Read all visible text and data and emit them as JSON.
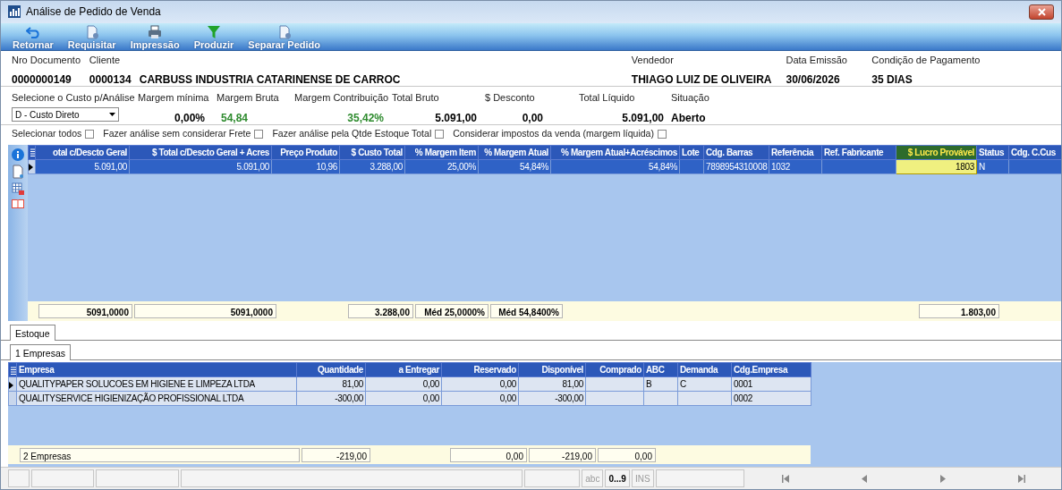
{
  "window": {
    "title": "Análise de Pedido de Venda"
  },
  "toolbar": [
    {
      "label": "Retornar",
      "kind": "undo"
    },
    {
      "label": "Requisitar",
      "kind": "document"
    },
    {
      "label": "Impressão",
      "kind": "printer"
    },
    {
      "label": "Produzir",
      "kind": "filter"
    },
    {
      "label": "Separar Pedido",
      "kind": "document"
    }
  ],
  "header": [
    {
      "label": "Nro Documento",
      "value": "0000000149"
    },
    {
      "label": "Cliente",
      "value": "0000134"
    },
    {
      "value": "CARBUSS INDUSTRIA CATARINENSE DE CARROC"
    },
    {
      "label": "Vendedor",
      "value": "THIAGO LUIZ DE OLIVEIRA"
    },
    {
      "label": "Data Emissão",
      "value": "30/06/2026"
    },
    {
      "label": "Condição de Pagamento",
      "value": "35 DIAS"
    }
  ],
  "analysis": {
    "cost_select": {
      "label": "Selecione o Custo p/Análise",
      "value": "D - Custo Direto"
    },
    "metrics": [
      {
        "label": "Margem mínima",
        "value": "0,00%",
        "color": "#000000"
      },
      {
        "label": "Margem Bruta",
        "value": "54,84",
        "color": "#2e8b2e"
      },
      {
        "label": "Margem Contribuição",
        "value": "35,42%",
        "color": "#2e8b2e"
      },
      {
        "label": "Total Bruto",
        "value": "5.091,00",
        "color": "#000000"
      },
      {
        "label": "$ Desconto",
        "value": "0,00",
        "color": "#000000"
      },
      {
        "label": "Total Líquido",
        "value": "5.091,00",
        "color": "#000000"
      },
      {
        "label": "Situação",
        "value": "Aberto",
        "color": "#000000"
      }
    ]
  },
  "options": [
    {
      "label": "Selecionar todos",
      "checked": false
    },
    {
      "label": "Fazer análise sem considerar Frete",
      "checked": false
    },
    {
      "label": "Fazer análise pela Qtde Estoque Total",
      "checked": false
    },
    {
      "label": "Considerar impostos da venda (margem líquida)",
      "checked": false
    }
  ],
  "grid": {
    "rows": [
      {
        "selected": true
      }
    ],
    "columns": [
      {
        "label": "otal c/Descto Geral",
        "kind": "number",
        "highlighted": false,
        "cells": [
          "5.091,00"
        ],
        "total": "5091,0000"
      },
      {
        "label": "$ Total c/Descto Geral + Acres",
        "kind": "number",
        "highlighted": false,
        "cells": [
          "5.091,00"
        ],
        "total": "5091,0000"
      },
      {
        "label": "Preço Produto",
        "kind": "number",
        "highlighted": false,
        "cells": [
          "10,96"
        ]
      },
      {
        "label": "$ Custo Total",
        "kind": "number",
        "highlighted": false,
        "cells": [
          "3.288,00"
        ],
        "total": "3.288,00"
      },
      {
        "label": "% Margem Item",
        "kind": "number",
        "highlighted": false,
        "cells": [
          "25,00%"
        ],
        "total": "Méd 25,0000%"
      },
      {
        "label": "% Margem Atual",
        "kind": "number",
        "highlighted": false,
        "cells": [
          "54,84%"
        ],
        "total": "Méd 54,8400%"
      },
      {
        "label": "% Margem Atual+Acréscimos",
        "kind": "number",
        "highlighted": false,
        "cells": [
          "54,84%"
        ]
      },
      {
        "label": "Lote",
        "kind": "text",
        "highlighted": false
      },
      {
        "label": "Cdg. Barras",
        "kind": "text",
        "highlighted": false,
        "cells": [
          "7898954310008"
        ]
      },
      {
        "label": "Referência",
        "kind": "text",
        "highlighted": false,
        "cells": [
          "1032"
        ]
      },
      {
        "label": "Ref. Fabricante",
        "kind": "text",
        "highlighted": false
      },
      {
        "label": "$ Lucro Provável",
        "kind": "number",
        "highlighted": true,
        "cells": [
          "1803"
        ],
        "total": "1.803,00"
      },
      {
        "label": "Status",
        "kind": "text",
        "highlighted": false,
        "cells": [
          "N"
        ]
      },
      {
        "label": "Cdg. C.Cus",
        "kind": "text",
        "highlighted": false
      }
    ]
  },
  "tabs": [
    {
      "label": "Estoque",
      "selected": true
    }
  ],
  "subtabs": [
    {
      "label": "1 Empresas",
      "selected": true
    }
  ],
  "stock": {
    "rows": [
      {
        "selected": true
      },
      {
        "selected": false
      }
    ],
    "columns": [
      {
        "label": "Empresa",
        "kind": "text",
        "cells": [
          "QUALITYPAPER SOLUCOES EM HIGIENE E LIMPEZA LTDA",
          "QUALITYSERVICE HIGIENIZAÇÃO PROFISSIONAL LTDA"
        ],
        "total": "2 Empresas"
      },
      {
        "label": "Quantidade",
        "kind": "number",
        "cells": [
          "81,00",
          "-300,00"
        ],
        "total": "-219,00"
      },
      {
        "label": "a Entregar",
        "kind": "number",
        "cells": [
          "0,00",
          "0,00"
        ]
      },
      {
        "label": "Reservado",
        "kind": "number",
        "cells": [
          "0,00",
          "0,00"
        ],
        "total": "0,00"
      },
      {
        "label": "Disponível",
        "kind": "number",
        "cells": [
          "81,00",
          "-300,00"
        ],
        "total": "-219,00"
      },
      {
        "label": "Comprado",
        "kind": "number",
        "total": "0,00"
      },
      {
        "label": "ABC",
        "kind": "text",
        "cells": [
          "B"
        ]
      },
      {
        "label": "Demanda",
        "kind": "text",
        "cells": [
          "C"
        ]
      },
      {
        "label": "Cdg.Empresa",
        "kind": "text",
        "cells": [
          "0001",
          "0002"
        ]
      }
    ]
  },
  "status_bar": [
    {
      "label": "abc",
      "on": false
    },
    {
      "label": "0...9",
      "on": true
    },
    {
      "label": "INS",
      "on": false
    }
  ]
}
